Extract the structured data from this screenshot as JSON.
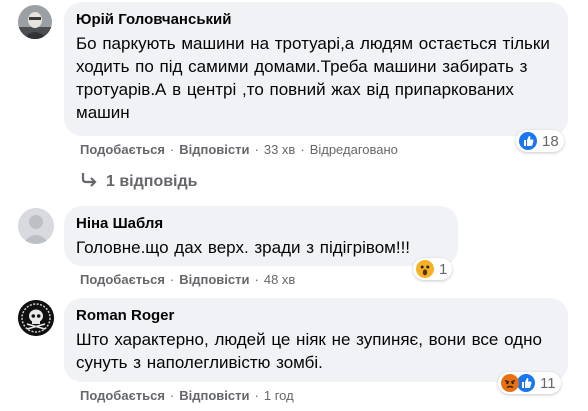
{
  "comments": [
    {
      "author": "Юрій Головчанський",
      "text": "Бо паркують машини на тротуарі,а людям остається тільки ходить по під самими домами.Треба машини забирать з тротуарів.А в центрі ,то повний жах від припаркованих машин",
      "actions": {
        "like": "Подобається",
        "reply": "Відповісти",
        "time": "33 хв",
        "edited": "Відредаговано"
      },
      "reactions": {
        "icons": [
          "like-icon"
        ],
        "count": "18"
      },
      "replies_label": "1 відповідь"
    },
    {
      "author": "Ніна Шабля",
      "text": "Головне.що дах верх. зради з підігрівом!!!",
      "actions": {
        "like": "Подобається",
        "reply": "Відповісти",
        "time": "48 хв"
      },
      "reactions": {
        "icons": [
          "wow-icon"
        ],
        "count": "1"
      }
    },
    {
      "author": "Roman Roger",
      "text": "Што характерно, людей це ніяк не зупиняє, вони все одно сунуть з наполегливістю зомбі.",
      "actions": {
        "like": "Подобається",
        "reply": "Відповісти",
        "time": "1 год"
      },
      "reactions": {
        "icons": [
          "angry-icon",
          "like-icon"
        ],
        "count": "11"
      }
    }
  ],
  "colors": {
    "bubble": "#f0f2f5",
    "meta_text": "#65676b",
    "like_blue": "#1877f2",
    "wow_yellow": "#f7b125",
    "angry_red": "#e9710f"
  }
}
